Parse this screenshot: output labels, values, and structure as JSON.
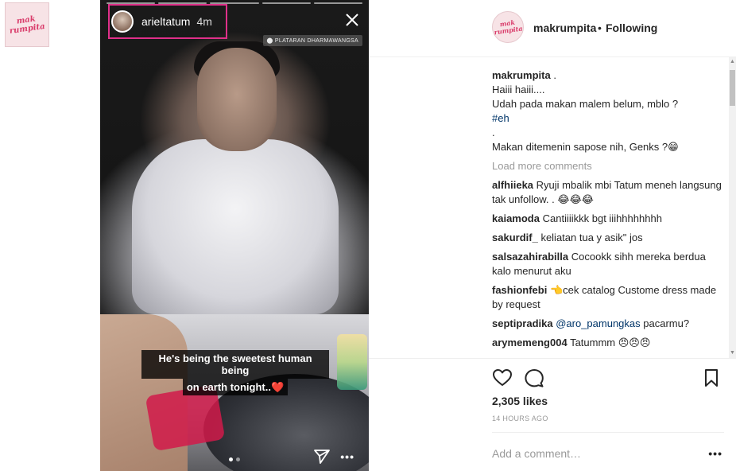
{
  "page_logo": {
    "line1": "mak",
    "line2": "rumpita"
  },
  "story": {
    "username": "arieltatum",
    "time": "4m",
    "location": "PLATARAN DHARMAWANGSA",
    "caption_line1": "He's being the sweetest human being",
    "caption_line2": "on earth tonight..❤️"
  },
  "header": {
    "username": "makrumpita",
    "separator": "•",
    "follow_status": "Following"
  },
  "caption": {
    "username": "makrumpita",
    "suffix": ".",
    "line1": "Haiii haiii....",
    "line2": "Udah pada makan malem belum, mblo ?",
    "hashtag": "#eh",
    "dot": ".",
    "line3": "Makan ditemenin sapose nih, Genks ?😁"
  },
  "load_more_label": "Load more comments",
  "comments": [
    {
      "user": "alfhiieka",
      "text": "Ryuji mbalik mbi Tatum meneh langsung tak unfollow. . 😂😂😂"
    },
    {
      "user": "kaiamoda",
      "text": "Cantiiiikkk bgt iiihhhhhhhh"
    },
    {
      "user": "sakurdif_",
      "text": "keliatan tua y asik\" jos"
    },
    {
      "user": "salsazahirabilla",
      "text": "Cocookk sihh mereka berdua kalo menurut aku"
    },
    {
      "user": "fashionfebi",
      "text": "👈cek catalog Custome dress made by request"
    },
    {
      "user": "septipradika",
      "mention": "@aro_pamungkas",
      "text": " pacarmu?"
    },
    {
      "user": "arymemeng004",
      "text": "Tatummm 😠😠😠"
    }
  ],
  "likes": "2,305 likes",
  "timestamp": "14 HOURS AGO",
  "add_comment_placeholder": "Add a comment…",
  "colors": {
    "story_highlight": "#e0308a",
    "link": "#003569",
    "muted": "#999999"
  },
  "icons": [
    "close-icon",
    "location-pin-icon",
    "send-icon",
    "heart-icon",
    "comment-bubble-icon",
    "bookmark-icon",
    "more-options-icon"
  ]
}
